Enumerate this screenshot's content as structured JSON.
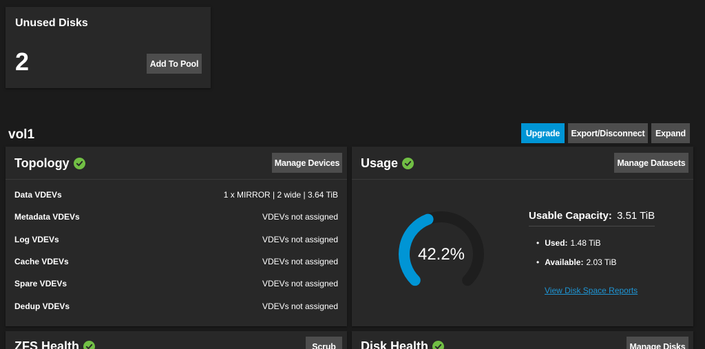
{
  "unused_disks": {
    "title": "Unused Disks",
    "count": "2",
    "add_button": "Add To Pool"
  },
  "pool": {
    "name": "vol1",
    "actions": {
      "upgrade": "Upgrade",
      "export": "Export/Disconnect",
      "expand": "Expand"
    }
  },
  "topology": {
    "title": "Topology",
    "manage_button": "Manage Devices",
    "rows": [
      {
        "label": "Data VDEVs",
        "value": "1 x MIRROR | 2 wide | 3.64 TiB"
      },
      {
        "label": "Metadata VDEVs",
        "value": "VDEVs not assigned"
      },
      {
        "label": "Log VDEVs",
        "value": "VDEVs not assigned"
      },
      {
        "label": "Cache VDEVs",
        "value": "VDEVs not assigned"
      },
      {
        "label": "Spare VDEVs",
        "value": "VDEVs not assigned"
      },
      {
        "label": "Dedup VDEVs",
        "value": "VDEVs not assigned"
      }
    ]
  },
  "usage": {
    "title": "Usage",
    "manage_button": "Manage Datasets",
    "percent_label": "42.2%",
    "percent_value": 42.2,
    "capacity_label": "Usable Capacity:",
    "capacity_value": "3.51 TiB",
    "used_label": "Used:",
    "used_value": "1.48 TiB",
    "available_label": "Available:",
    "available_value": "2.03 TiB",
    "report_link": "View Disk Space Reports"
  },
  "zfs_health": {
    "title": "ZFS Health",
    "scrub_button": "Scrub"
  },
  "disk_health": {
    "title": "Disk Health",
    "manage_button": "Manage Disks"
  },
  "colors": {
    "accent": "#0095d5",
    "success": "#71bf44",
    "card": "#282828",
    "background": "#1b1b1b",
    "gauge_track": "#1e1e1e",
    "link": "#1e96d6"
  }
}
